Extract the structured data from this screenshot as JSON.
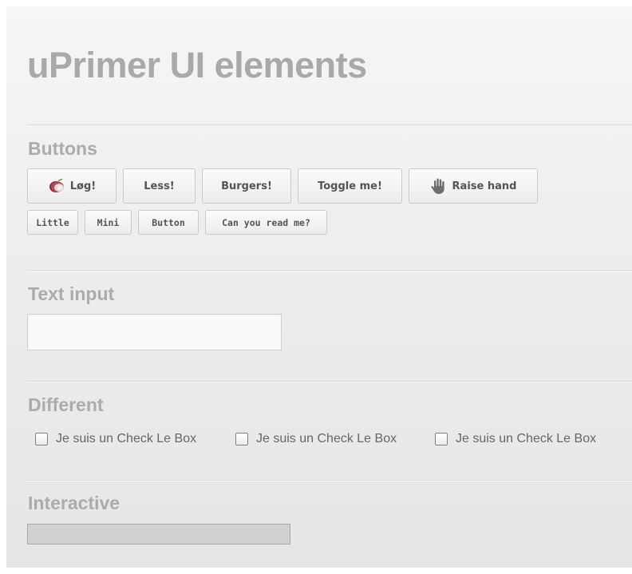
{
  "page": {
    "title": "uPrimer UI elements"
  },
  "sections": {
    "buttons": {
      "heading": "Buttons",
      "large": [
        {
          "label": "Løg!",
          "icon": "onion-icon"
        },
        {
          "label": "Less!"
        },
        {
          "label": "Burgers!"
        },
        {
          "label": "Toggle me!"
        },
        {
          "label": "Raise hand",
          "icon": "hand-icon"
        }
      ],
      "small": [
        {
          "label": "Little"
        },
        {
          "label": "Mini"
        },
        {
          "label": "Button"
        },
        {
          "label": "Can you read me?"
        }
      ]
    },
    "text_input": {
      "heading": "Text input",
      "value": "",
      "placeholder": ""
    },
    "different": {
      "heading": "Different",
      "checkboxes": [
        {
          "label": "Je suis un Check Le Box",
          "checked": false
        },
        {
          "label": "Je suis un Check Le Box",
          "checked": false
        },
        {
          "label": "Je suis un Check Le Box",
          "checked": false
        }
      ]
    },
    "interactive": {
      "heading": "Interactive",
      "progress_fraction": 1.0
    }
  },
  "colors": {
    "heading": "#a9a9a9",
    "button_text": "#545454",
    "onion": "#8e2a3c",
    "hand": "#6e6e6e"
  }
}
